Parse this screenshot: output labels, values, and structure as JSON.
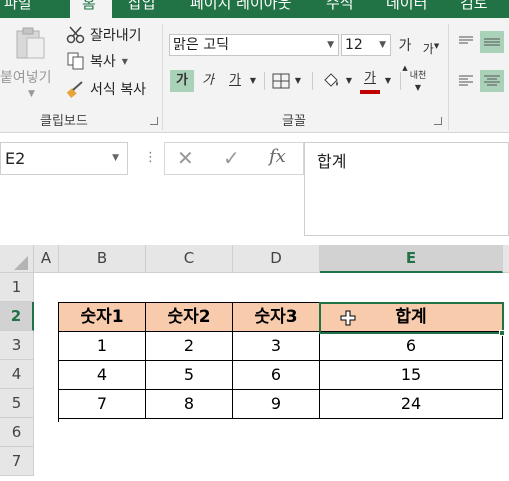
{
  "ribbon_tabs": [
    {
      "label": "파일"
    },
    {
      "label": "홈"
    },
    {
      "label": "삽입"
    },
    {
      "label": "페이지 레이아웃"
    },
    {
      "label": "수식"
    },
    {
      "label": "데이터"
    },
    {
      "label": "검토"
    }
  ],
  "clipboard": {
    "paste_label": "붙여넣기",
    "cut_label": "잘라내기",
    "copy_label": "복사",
    "format_painter_label": "서식 복사",
    "group_label": "클립보드"
  },
  "font": {
    "font_name": "맑은 고딕",
    "font_size": "12",
    "grow_label": "가",
    "shrink_label": "가",
    "bold_label": "가",
    "italic_label": "가",
    "underline_label": "가",
    "font_color_label": "가",
    "phonetic_label": "내천",
    "group_label": "글꼴"
  },
  "formula_bar": {
    "name_box": "E2",
    "fx_label": "fx",
    "content": "합계"
  },
  "sheet": {
    "columns": [
      "A",
      "B",
      "C",
      "D",
      "E"
    ],
    "selected_column": "E",
    "rows": [
      "1",
      "2",
      "3",
      "4",
      "5",
      "6",
      "7"
    ],
    "selected_row": "2",
    "table_header": [
      "숫자1",
      "숫자2",
      "숫자3",
      "합계"
    ],
    "table_rows": [
      [
        "1",
        "2",
        "3",
        "6"
      ],
      [
        "4",
        "5",
        "6",
        "15"
      ],
      [
        "7",
        "8",
        "9",
        "24"
      ]
    ]
  },
  "colors": {
    "ribbon_green": "#217346",
    "header_fill": "#f8cbad",
    "toggle_on": "#a9d2b8"
  }
}
